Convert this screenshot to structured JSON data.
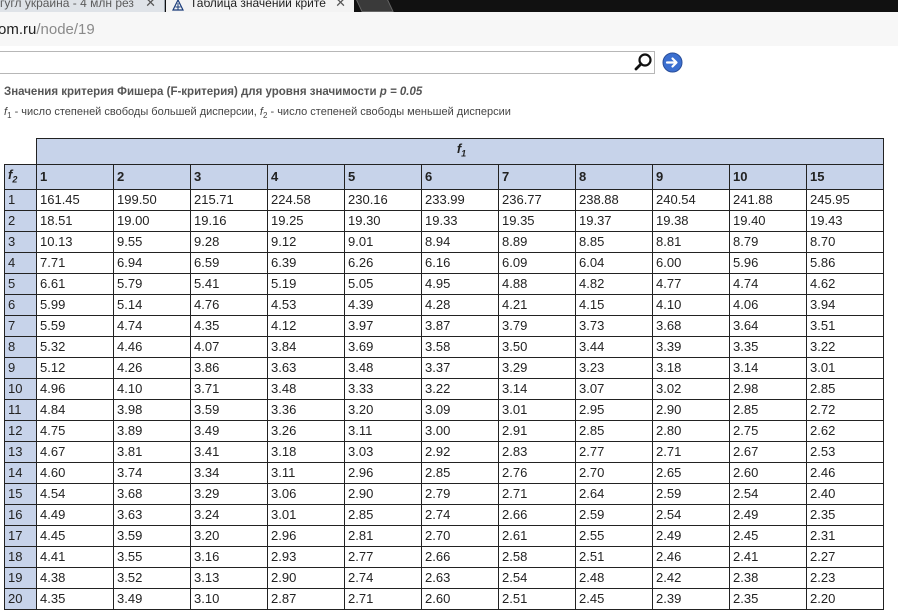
{
  "browser": {
    "tab1_title": "гугл украина - 4 млн рез",
    "tab2_title": "Таблица значений крите",
    "close_glyph": "✕",
    "url_domain": "om.ru",
    "url_path": "/node/19"
  },
  "page": {
    "title_prefix": "Значения критерия Фишера (F-критерия) для уровня значимости ",
    "title_p": "p = 0.05",
    "subtitle": {
      "f1_sym": "f",
      "f1_sub": "1",
      "f1_text": " - число степеней свободы большей дисперсии, ",
      "f2_sym": "f",
      "f2_sub": "2",
      "f2_text": " - число степеней свободы меньшей дисперсии"
    }
  },
  "table": {
    "f1_label": "f1",
    "f2_label": "f2",
    "columns": [
      "1",
      "2",
      "3",
      "4",
      "5",
      "6",
      "7",
      "8",
      "9",
      "10",
      "15"
    ],
    "rows": [
      {
        "f2": "1",
        "values": [
          "161.45",
          "199.50",
          "215.71",
          "224.58",
          "230.16",
          "233.99",
          "236.77",
          "238.88",
          "240.54",
          "241.88",
          "245.95"
        ]
      },
      {
        "f2": "2",
        "values": [
          "18.51",
          "19.00",
          "19.16",
          "19.25",
          "19.30",
          "19.33",
          "19.35",
          "19.37",
          "19.38",
          "19.40",
          "19.43"
        ]
      },
      {
        "f2": "3",
        "values": [
          "10.13",
          "9.55",
          "9.28",
          "9.12",
          "9.01",
          "8.94",
          "8.89",
          "8.85",
          "8.81",
          "8.79",
          "8.70"
        ]
      },
      {
        "f2": "4",
        "values": [
          "7.71",
          "6.94",
          "6.59",
          "6.39",
          "6.26",
          "6.16",
          "6.09",
          "6.04",
          "6.00",
          "5.96",
          "5.86"
        ]
      },
      {
        "f2": "5",
        "values": [
          "6.61",
          "5.79",
          "5.41",
          "5.19",
          "5.05",
          "4.95",
          "4.88",
          "4.82",
          "4.77",
          "4.74",
          "4.62"
        ]
      },
      {
        "f2": "6",
        "values": [
          "5.99",
          "5.14",
          "4.76",
          "4.53",
          "4.39",
          "4.28",
          "4.21",
          "4.15",
          "4.10",
          "4.06",
          "3.94"
        ]
      },
      {
        "f2": "7",
        "values": [
          "5.59",
          "4.74",
          "4.35",
          "4.12",
          "3.97",
          "3.87",
          "3.79",
          "3.73",
          "3.68",
          "3.64",
          "3.51"
        ]
      },
      {
        "f2": "8",
        "values": [
          "5.32",
          "4.46",
          "4.07",
          "3.84",
          "3.69",
          "3.58",
          "3.50",
          "3.44",
          "3.39",
          "3.35",
          "3.22"
        ]
      },
      {
        "f2": "9",
        "values": [
          "5.12",
          "4.26",
          "3.86",
          "3.63",
          "3.48",
          "3.37",
          "3.29",
          "3.23",
          "3.18",
          "3.14",
          "3.01"
        ]
      },
      {
        "f2": "10",
        "values": [
          "4.96",
          "4.10",
          "3.71",
          "3.48",
          "3.33",
          "3.22",
          "3.14",
          "3.07",
          "3.02",
          "2.98",
          "2.85"
        ]
      },
      {
        "f2": "11",
        "values": [
          "4.84",
          "3.98",
          "3.59",
          "3.36",
          "3.20",
          "3.09",
          "3.01",
          "2.95",
          "2.90",
          "2.85",
          "2.72"
        ]
      },
      {
        "f2": "12",
        "values": [
          "4.75",
          "3.89",
          "3.49",
          "3.26",
          "3.11",
          "3.00",
          "2.91",
          "2.85",
          "2.80",
          "2.75",
          "2.62"
        ]
      },
      {
        "f2": "13",
        "values": [
          "4.67",
          "3.81",
          "3.41",
          "3.18",
          "3.03",
          "2.92",
          "2.83",
          "2.77",
          "2.71",
          "2.67",
          "2.53"
        ]
      },
      {
        "f2": "14",
        "values": [
          "4.60",
          "3.74",
          "3.34",
          "3.11",
          "2.96",
          "2.85",
          "2.76",
          "2.70",
          "2.65",
          "2.60",
          "2.46"
        ]
      },
      {
        "f2": "15",
        "values": [
          "4.54",
          "3.68",
          "3.29",
          "3.06",
          "2.90",
          "2.79",
          "2.71",
          "2.64",
          "2.59",
          "2.54",
          "2.40"
        ]
      },
      {
        "f2": "16",
        "values": [
          "4.49",
          "3.63",
          "3.24",
          "3.01",
          "2.85",
          "2.74",
          "2.66",
          "2.59",
          "2.54",
          "2.49",
          "2.35"
        ]
      },
      {
        "f2": "17",
        "values": [
          "4.45",
          "3.59",
          "3.20",
          "2.96",
          "2.81",
          "2.70",
          "2.61",
          "2.55",
          "2.49",
          "2.45",
          "2.31"
        ]
      },
      {
        "f2": "18",
        "values": [
          "4.41",
          "3.55",
          "3.16",
          "2.93",
          "2.77",
          "2.66",
          "2.58",
          "2.51",
          "2.46",
          "2.41",
          "2.27"
        ]
      },
      {
        "f2": "19",
        "values": [
          "4.38",
          "3.52",
          "3.13",
          "2.90",
          "2.74",
          "2.63",
          "2.54",
          "2.48",
          "2.42",
          "2.38",
          "2.23"
        ]
      },
      {
        "f2": "20",
        "values": [
          "4.35",
          "3.49",
          "3.10",
          "2.87",
          "2.71",
          "2.60",
          "2.51",
          "2.45",
          "2.39",
          "2.35",
          "2.20"
        ]
      }
    ]
  },
  "colors": {
    "header_bg": "#c7d3ea",
    "tabbar_bg": "#111111",
    "go_button": "#3b6fd0"
  },
  "icons": {
    "search": "magnifier-icon",
    "go": "arrow-right-circle-icon",
    "favicon": "triangle-logo-icon"
  }
}
